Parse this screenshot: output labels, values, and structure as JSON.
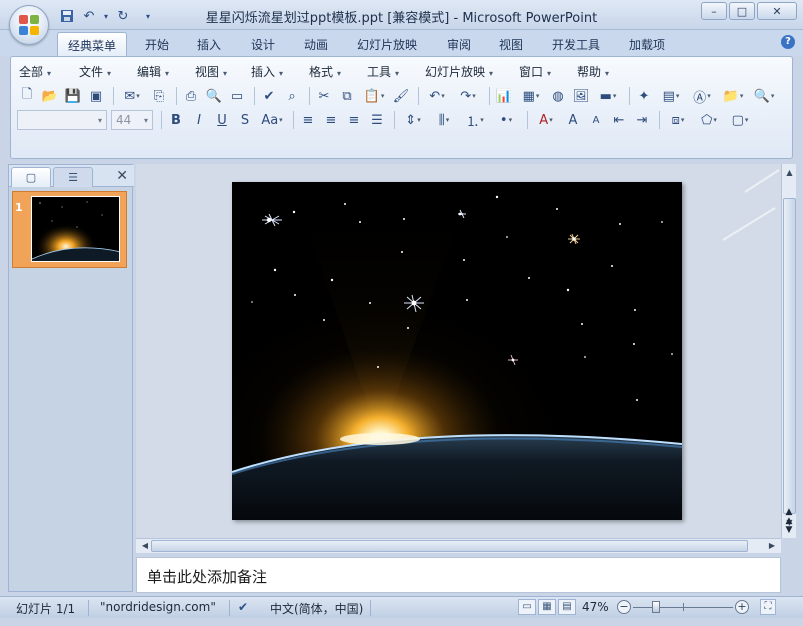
{
  "window": {
    "title": "星星闪烁流星划过ppt模板.ppt [兼容模式] - Microsoft PowerPoint",
    "minimize": "–",
    "maximize": "□",
    "close": "✕"
  },
  "ribbon_tabs": [
    "经典菜单",
    "开始",
    "插入",
    "设计",
    "动画",
    "幻灯片放映",
    "审阅",
    "视图",
    "开发工具",
    "加载项"
  ],
  "active_tab": "经典菜单",
  "help": "?",
  "classic_menu": [
    "全部",
    "文件",
    "编辑",
    "视图",
    "插入",
    "格式",
    "工具",
    "幻灯片放映",
    "窗口",
    "帮助"
  ],
  "font_combo": {
    "font_name": "",
    "font_size": "44"
  },
  "formatting": {
    "bold": "B",
    "italic": "I",
    "underline": "U",
    "shadow": "S",
    "case": "Aa"
  },
  "left_pane": {
    "slide_number": "1",
    "close": "✕"
  },
  "notes": {
    "placeholder": "单击此处添加备注"
  },
  "status": {
    "slide_info": "幻灯片 1/1",
    "theme": "\"nordridesign.com\"",
    "language": "中文(简体，中国)",
    "zoom": "47%",
    "zoom_level": 0.47
  },
  "icons": {
    "office": "office-logo-icon",
    "save": "save-icon",
    "undo": "undo-icon",
    "redo": "redo-icon"
  }
}
